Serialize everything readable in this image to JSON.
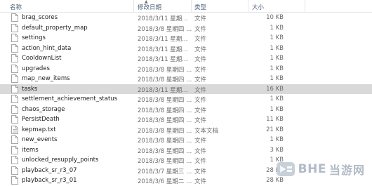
{
  "columns": {
    "name": "名称",
    "date": "修改日期",
    "type": "类型",
    "size": "大小"
  },
  "files": [
    {
      "name": "brag_scores",
      "date": "2018/3/11 星期...",
      "type": "文件",
      "size": "10 KB",
      "icon": "file-icon"
    },
    {
      "name": "default_property_map",
      "date": "2018/3/8 星期四 ...",
      "type": "文件",
      "size": "1 KB",
      "icon": "file-icon"
    },
    {
      "name": "settings",
      "date": "2018/3/11 星期...",
      "type": "文件",
      "size": "1 KB",
      "icon": "file-icon"
    },
    {
      "name": "action_hint_data",
      "date": "2018/3/11 星期...",
      "type": "文件",
      "size": "1 KB",
      "icon": "file-icon"
    },
    {
      "name": "CooldownList",
      "date": "2018/3/11 星期...",
      "type": "文件",
      "size": "1 KB",
      "icon": "file-icon"
    },
    {
      "name": "upgrades",
      "date": "2018/3/8 星期四 ...",
      "type": "文件",
      "size": "1 KB",
      "icon": "file-icon"
    },
    {
      "name": "map_new_items",
      "date": "2018/3/8 星期四 ...",
      "type": "文件",
      "size": "1 KB",
      "icon": "file-icon"
    },
    {
      "name": "tasks",
      "date": "2018/3/11 星期...",
      "type": "文件",
      "size": "16 KB",
      "icon": "file-icon",
      "selected": true
    },
    {
      "name": "settlement_achievement_status",
      "date": "2018/3/8 星期四 ...",
      "type": "文件",
      "size": "1 KB",
      "icon": "file-icon"
    },
    {
      "name": "chaos_storage",
      "date": "2018/3/8 星期四 ...",
      "type": "文件",
      "size": "1 KB",
      "icon": "file-icon"
    },
    {
      "name": "PersistDeath",
      "date": "2018/3/8 星期四 ...",
      "type": "文件",
      "size": "11 KB",
      "icon": "file-icon"
    },
    {
      "name": "kepmap.txt",
      "date": "2018/3/8 星期四 ...",
      "type": "文本文档",
      "size": "21 KB",
      "icon": "text-file-icon"
    },
    {
      "name": "new_events",
      "date": "2018/3/8 星期四 ...",
      "type": "文件",
      "size": "1 KB",
      "icon": "file-icon"
    },
    {
      "name": "items",
      "date": "2018/3/8 星期四 ...",
      "type": "文件",
      "size": "3 KB",
      "icon": "file-icon"
    },
    {
      "name": "unlocked_resupply_points",
      "date": "2018/3/8 星期四 ...",
      "type": "文件",
      "size": "1 KB",
      "icon": "file-icon"
    },
    {
      "name": "playback_sr_r3_07",
      "date": "2018/3/7 星期三 ...",
      "type": "文件",
      "size": "28 KB",
      "icon": "file-icon"
    },
    {
      "name": "playback_sr_r3_01",
      "date": "2018/3/6 星期二 ...",
      "type": "文件",
      "size": "28 KB",
      "icon": "file-icon"
    }
  ],
  "watermark": {
    "brand": "BHE",
    "text": "当游网"
  },
  "colors": {
    "selected_row": "#d9d9d9",
    "header_text": "#4c607a",
    "watermark": "#a9b4bf"
  }
}
